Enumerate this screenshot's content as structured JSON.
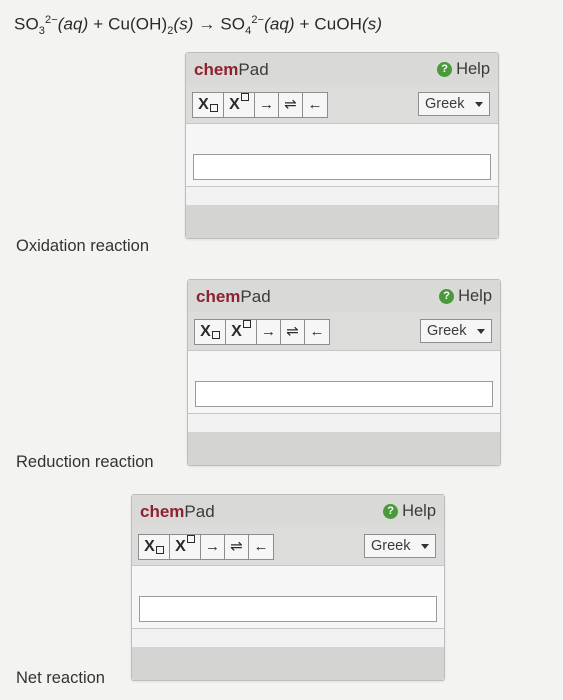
{
  "equation": {
    "r1_base": "SO",
    "r1_sub": "3",
    "r1_sup": "2−",
    "r1_state": "(aq)",
    "plus1": "+",
    "r2": "Cu(OH)",
    "r2_sub": "2",
    "r2_state": "(s)",
    "arrow": "→",
    "p1_base": "SO",
    "p1_sub": "4",
    "p1_sup": "2−",
    "p1_state": "(aq)",
    "plus2": "+",
    "p2": "CuOH",
    "p2_state": "(s)"
  },
  "pads": [
    {
      "title_bold": "chem",
      "title_rest": "Pad",
      "help": "Help",
      "subscript_tool": "X",
      "superscript_tool": "X",
      "arrow_tool": "→",
      "equilibrium_tool": "⇌",
      "back_tool": "←",
      "greek": "Greek",
      "label": "Oxidation reaction"
    },
    {
      "title_bold": "chem",
      "title_rest": "Pad",
      "help": "Help",
      "subscript_tool": "X",
      "superscript_tool": "X",
      "arrow_tool": "→",
      "equilibrium_tool": "⇌",
      "back_tool": "←",
      "greek": "Greek",
      "label": "Reduction reaction"
    },
    {
      "title_bold": "chem",
      "title_rest": "Pad",
      "help": "Help",
      "subscript_tool": "X",
      "superscript_tool": "X",
      "arrow_tool": "→",
      "equilibrium_tool": "⇌",
      "back_tool": "←",
      "greek": "Greek",
      "label": "Net reaction"
    }
  ]
}
